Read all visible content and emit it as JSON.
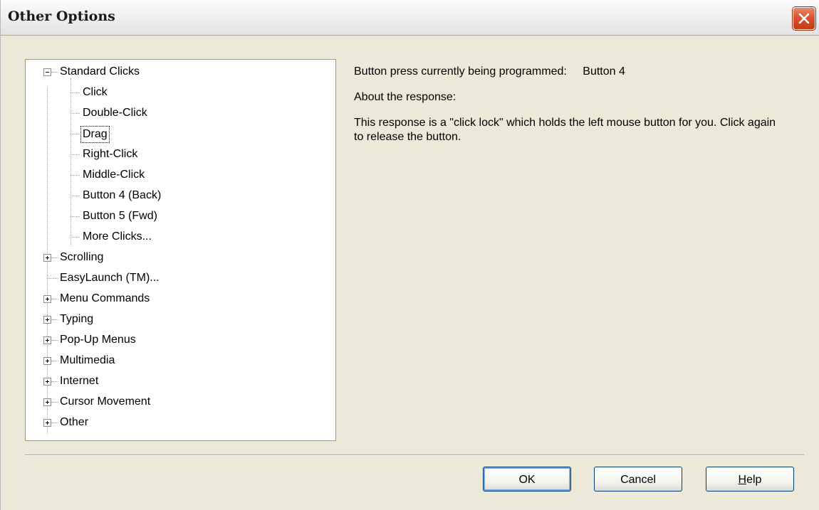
{
  "window": {
    "title": "Other Options"
  },
  "tree": {
    "standard_clicks": {
      "label": "Standard Clicks",
      "expanded": true,
      "children": [
        "Click",
        "Double-Click",
        "Drag",
        "Right-Click",
        "Middle-Click",
        "Button 4 (Back)",
        "Button 5 (Fwd)",
        "More Clicks..."
      ],
      "selected": "Drag"
    },
    "root_items": [
      {
        "label": "Scrolling",
        "expandable": true
      },
      {
        "label": "EasyLaunch (TM)...",
        "expandable": false
      },
      {
        "label": "Menu Commands",
        "expandable": true
      },
      {
        "label": "Typing",
        "expandable": true
      },
      {
        "label": "Pop-Up Menus",
        "expandable": true
      },
      {
        "label": "Multimedia",
        "expandable": true
      },
      {
        "label": "Internet",
        "expandable": true
      },
      {
        "label": "Cursor Movement",
        "expandable": true
      },
      {
        "label": "Other",
        "expandable": true
      }
    ]
  },
  "info": {
    "programmed_label": "Button press currently being programmed:",
    "programmed_value": "Button 4",
    "about_label": "About the response:",
    "description": "This response is a \"click lock\" which holds the left mouse button for you. Click again to release the button."
  },
  "buttons": {
    "ok": "OK",
    "cancel": "Cancel",
    "help_mnemonic": "H",
    "help_rest": "elp"
  },
  "icons": {
    "close": "close-icon",
    "expand": "plus-icon",
    "collapse": "minus-icon"
  },
  "colors": {
    "close_button": "#d9542f",
    "tree_border": "#7f9db9",
    "dialog_bg": "#ece9d8"
  }
}
